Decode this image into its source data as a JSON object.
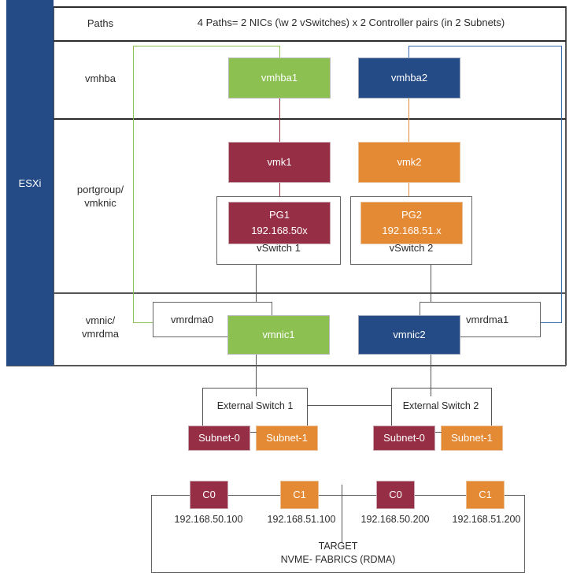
{
  "diagram": {
    "title": "ESXi NVMe over Fabrics (RDMA) multipath topology",
    "esxi_label": "ESXi",
    "colors": {
      "green": "#8cc152",
      "blue": "#254b87",
      "maroon": "#962f45",
      "orange": "#e58a34",
      "line_gray": "#555555",
      "line_blue": "#3b68b0"
    }
  },
  "table": {
    "rows": [
      {
        "label": "Paths",
        "value": "4 Paths= 2 NICs (\\w 2 vSwitches) x 2 Controller pairs (in 2 Subnets)"
      },
      {
        "label": "vmhba",
        "value": ""
      },
      {
        "label": "portgroup/\nvmknic",
        "label_line1": "portgroup/",
        "label_line2": "vmknic",
        "value": ""
      },
      {
        "label": "vmnic/\nvmrdma",
        "label_line1": "vmnic/",
        "label_line2": "vmrdma",
        "value": ""
      }
    ]
  },
  "hba": {
    "vmhba1": "vmhba1",
    "vmhba2": "vmhba2"
  },
  "vmknic": {
    "vmk1": "vmk1",
    "vmk2": "vmk2"
  },
  "portgroups": [
    {
      "name": "PG1",
      "subnet": "192.168.50x",
      "vswitch": "vSwitch 1",
      "color": "maroon"
    },
    {
      "name": "PG2",
      "subnet": "192.168.51.x",
      "vswitch": "vSwitch 2",
      "color": "orange"
    }
  ],
  "vmnic": {
    "vmnic1": "vmnic1",
    "vmnic2": "vmnic2",
    "vmrdma0": "vmrdma0",
    "vmrdma1": "vmrdma1"
  },
  "external_switches": [
    {
      "name": "External Switch 1",
      "subnets": [
        {
          "label": "Subnet-0",
          "color": "maroon"
        },
        {
          "label": "Subnet-1",
          "color": "orange"
        }
      ]
    },
    {
      "name": "External Switch 2",
      "subnets": [
        {
          "label": "Subnet-0",
          "color": "maroon"
        },
        {
          "label": "Subnet-1",
          "color": "orange"
        }
      ]
    }
  ],
  "target": {
    "title_line1": "TARGET",
    "title_line2": "NVME- FABRICS (RDMA)",
    "controllers": [
      {
        "name": "C0",
        "ip": "192.168.50.100",
        "color": "maroon"
      },
      {
        "name": "C1",
        "ip": "192.168.51.100",
        "color": "orange"
      },
      {
        "name": "C0",
        "ip": "192.168.50.200",
        "color": "maroon"
      },
      {
        "name": "C1",
        "ip": "192.168.51.200",
        "color": "orange"
      }
    ]
  }
}
